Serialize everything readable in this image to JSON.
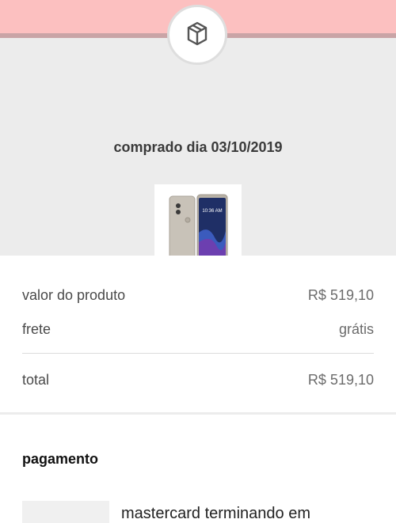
{
  "header": {
    "icon": "package-box-icon"
  },
  "order": {
    "purchase_date_label": "comprado dia 03/10/2019",
    "product_image": "smartphone-image",
    "phone_clock": "10:36 AM"
  },
  "summary": {
    "product_value_label": "valor do produto",
    "product_value": "R$ 519,10",
    "shipping_label": "frete",
    "shipping_value": "grátis",
    "total_label": "total",
    "total_value": "R$ 519,10"
  },
  "payment": {
    "title": "pagamento",
    "card_text": "mastercard terminando em"
  },
  "colors": {
    "top_band": "#fcc0c0",
    "hero_bg": "#ececec"
  }
}
